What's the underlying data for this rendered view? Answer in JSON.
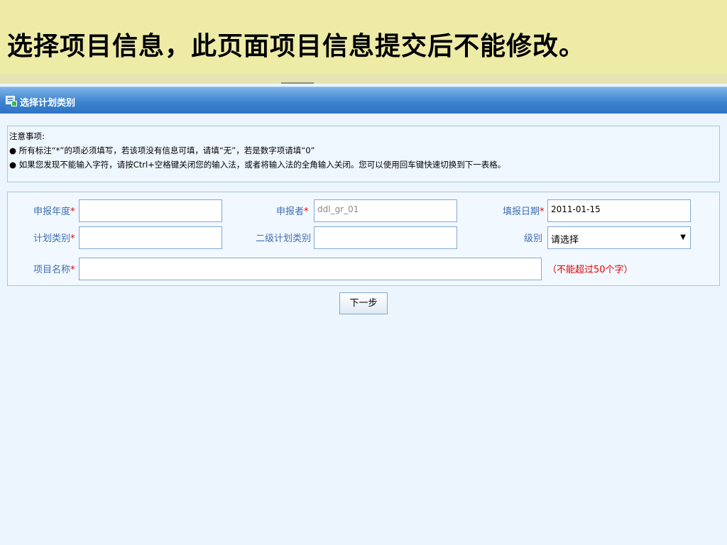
{
  "slide": {
    "title": "选择项目信息，此页面项目信息提交后不能修改。"
  },
  "panel": {
    "title": "选择计划类别",
    "icon": "form-icon"
  },
  "notice": {
    "heading": "注意事项:",
    "items": [
      "● 所有标注“*”的项必须填写，若该项没有信息可填，请填“无”，若是数字项请填“0”",
      "● 如果您发现不能输入字符，请按Ctrl+空格键关闭您的输入法，或者将输入法的全角输入关闭。您可以使用回车键快速切换到下一表格。"
    ]
  },
  "form": {
    "required_mark": "*",
    "year": {
      "label": "申报年度",
      "value": ""
    },
    "applicant": {
      "label": "申报者",
      "value": "ddl_gr_01"
    },
    "date": {
      "label": "填报日期",
      "value": "2011-01-15"
    },
    "plan_type": {
      "label": "计划类别",
      "value": ""
    },
    "sub_plan_type": {
      "label": "二级计划类别",
      "value": ""
    },
    "level": {
      "label": "级别",
      "selected": "请选择"
    },
    "project_name": {
      "label": "项目名称",
      "value": "",
      "hint": "（不能超过50个字）"
    }
  },
  "buttons": {
    "next": "下一步"
  },
  "colors": {
    "header_bg": "#eeeba7",
    "panel_bar": "#3d84cf",
    "label": "#3f6fb0",
    "required": "#e60000",
    "page_bg": "#ecf5fd"
  }
}
